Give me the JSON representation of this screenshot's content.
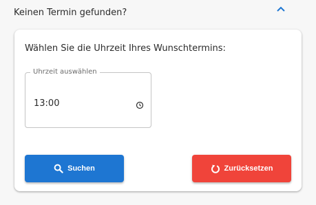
{
  "panel": {
    "title": "Keinen Termin gefunden?",
    "chevron_icon": "chevron-up-icon"
  },
  "card": {
    "heading": "Wählen Sie die Uhrzeit Ihres Wunschtermins:",
    "time_field": {
      "label": "Uhrzeit auswählen",
      "value": "13:00",
      "icon": "clock-icon"
    },
    "buttons": {
      "search_label": "Suchen",
      "search_icon": "search-icon",
      "reset_label": "Zurücksetzen",
      "reset_icon": "reset-icon"
    }
  },
  "colors": {
    "primary": "#1e76d2",
    "danger": "#f0443a",
    "chevron": "#1e76d2"
  }
}
